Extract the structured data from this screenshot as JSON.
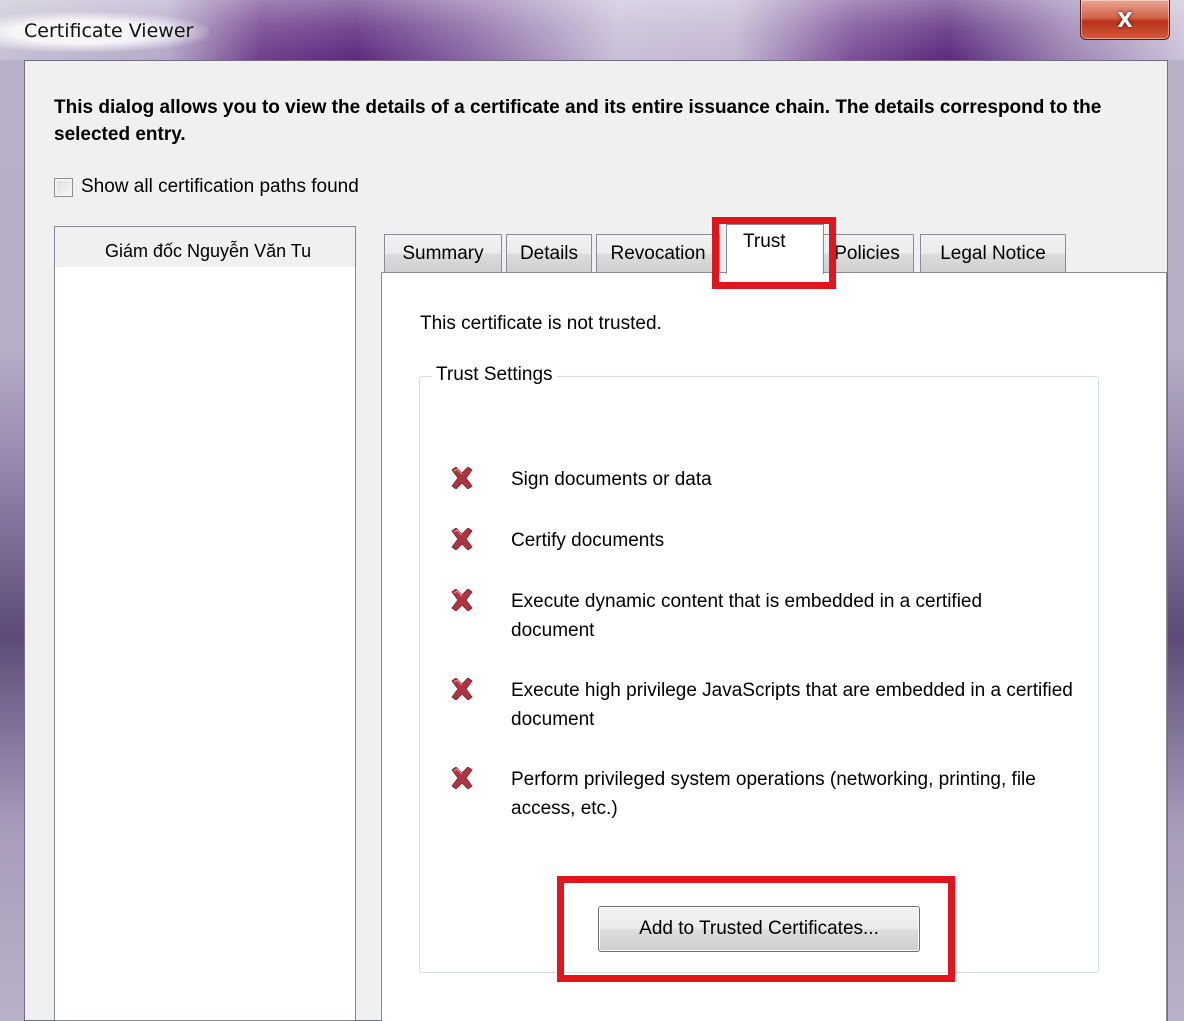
{
  "window": {
    "title": "Certificate Viewer",
    "close_glyph": "X"
  },
  "description": "This dialog allows you to view the details of a certificate and its entire issuance chain. The details correspond to the selected entry.",
  "show_all_paths": {
    "label": "Show all certification paths found",
    "checked": false
  },
  "certificate_tree": {
    "items": [
      {
        "label": "Giám đốc Nguyễn Văn Tu"
      }
    ]
  },
  "tabs": [
    {
      "label": "Summary",
      "active": false
    },
    {
      "label": "Details",
      "active": false
    },
    {
      "label": "Revocation",
      "active": false
    },
    {
      "label": "Trust",
      "active": true
    },
    {
      "label": "Policies",
      "active": false
    },
    {
      "label": "Legal Notice",
      "active": false
    }
  ],
  "trust": {
    "status_text": "This certificate is not trusted.",
    "group_label": "Trust Settings",
    "permissions": [
      {
        "icon": "x-mark-icon",
        "text": "Sign documents or data",
        "allowed": false
      },
      {
        "icon": "x-mark-icon",
        "text": "Certify documents",
        "allowed": false
      },
      {
        "icon": "x-mark-icon",
        "text": "Execute dynamic content that is embedded in a certified document",
        "allowed": false
      },
      {
        "icon": "x-mark-icon",
        "text": "Execute high privilege JavaScripts that are embedded in a certified document",
        "allowed": false
      },
      {
        "icon": "x-mark-icon",
        "text": "Perform privileged system operations (networking, printing, file access, etc.)",
        "allowed": false
      }
    ],
    "add_button_label": "Add to Trusted Certificates..."
  },
  "colors": {
    "highlight": "#e2151d",
    "deny_icon": "#b0343f"
  }
}
